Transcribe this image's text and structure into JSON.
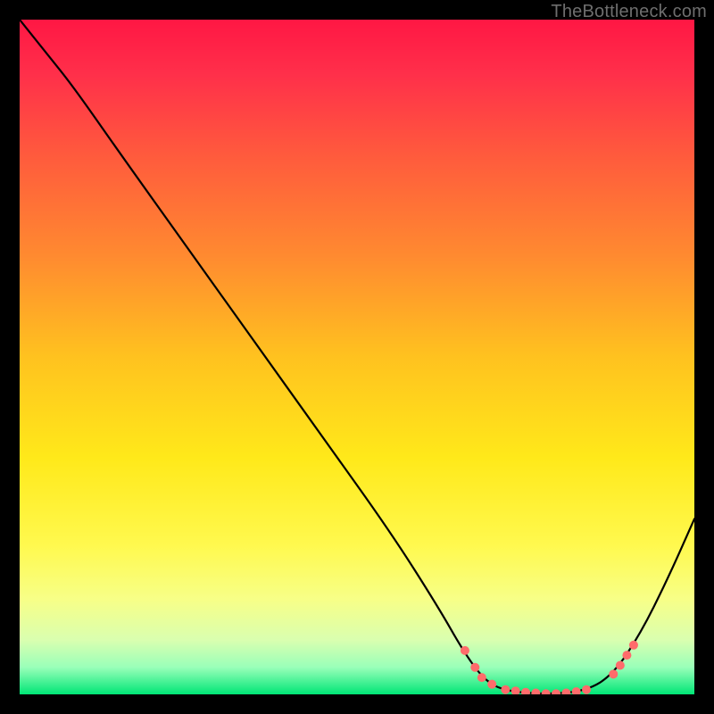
{
  "watermark": "TheBottleneck.com",
  "chart_data": {
    "type": "line",
    "title": "",
    "xlabel": "",
    "ylabel": "",
    "xlim": [
      0,
      100
    ],
    "ylim": [
      0,
      100
    ],
    "grid": false,
    "gradient_stops": [
      {
        "offset": 0.0,
        "color": "#ff1744"
      },
      {
        "offset": 0.08,
        "color": "#ff2f4a"
      },
      {
        "offset": 0.2,
        "color": "#ff5a3d"
      },
      {
        "offset": 0.35,
        "color": "#ff8a30"
      },
      {
        "offset": 0.5,
        "color": "#ffc21f"
      },
      {
        "offset": 0.65,
        "color": "#ffe91a"
      },
      {
        "offset": 0.78,
        "color": "#fff94f"
      },
      {
        "offset": 0.86,
        "color": "#f7ff88"
      },
      {
        "offset": 0.92,
        "color": "#d9ffb0"
      },
      {
        "offset": 0.96,
        "color": "#99ffb9"
      },
      {
        "offset": 1.0,
        "color": "#00e676"
      }
    ],
    "curve": [
      {
        "x": 0.0,
        "y": 100.0
      },
      {
        "x": 4.0,
        "y": 95.0
      },
      {
        "x": 8.0,
        "y": 90.0
      },
      {
        "x": 15.0,
        "y": 80.0
      },
      {
        "x": 25.0,
        "y": 66.0
      },
      {
        "x": 35.0,
        "y": 52.0
      },
      {
        "x": 45.0,
        "y": 38.0
      },
      {
        "x": 55.0,
        "y": 24.0
      },
      {
        "x": 62.0,
        "y": 13.0
      },
      {
        "x": 66.0,
        "y": 6.0
      },
      {
        "x": 69.0,
        "y": 2.0
      },
      {
        "x": 72.0,
        "y": 0.5
      },
      {
        "x": 78.0,
        "y": 0.0
      },
      {
        "x": 84.0,
        "y": 0.5
      },
      {
        "x": 88.0,
        "y": 3.0
      },
      {
        "x": 92.0,
        "y": 9.0
      },
      {
        "x": 96.0,
        "y": 17.0
      },
      {
        "x": 100.0,
        "y": 26.0
      }
    ],
    "markers": [
      {
        "x": 66.0,
        "y": 6.5
      },
      {
        "x": 67.5,
        "y": 4.0
      },
      {
        "x": 68.5,
        "y": 2.5
      },
      {
        "x": 70.0,
        "y": 1.5
      },
      {
        "x": 72.0,
        "y": 0.7
      },
      {
        "x": 73.5,
        "y": 0.5
      },
      {
        "x": 75.0,
        "y": 0.3
      },
      {
        "x": 76.5,
        "y": 0.2
      },
      {
        "x": 78.0,
        "y": 0.1
      },
      {
        "x": 79.5,
        "y": 0.1
      },
      {
        "x": 81.0,
        "y": 0.2
      },
      {
        "x": 82.5,
        "y": 0.4
      },
      {
        "x": 84.0,
        "y": 0.7
      },
      {
        "x": 88.0,
        "y": 3.0
      },
      {
        "x": 89.0,
        "y": 4.3
      },
      {
        "x": 90.0,
        "y": 5.8
      },
      {
        "x": 91.0,
        "y": 7.3
      }
    ],
    "marker_color": "#ff6b6b",
    "curve_color": "#000000",
    "curve_width": 2.2,
    "marker_radius": 5
  }
}
